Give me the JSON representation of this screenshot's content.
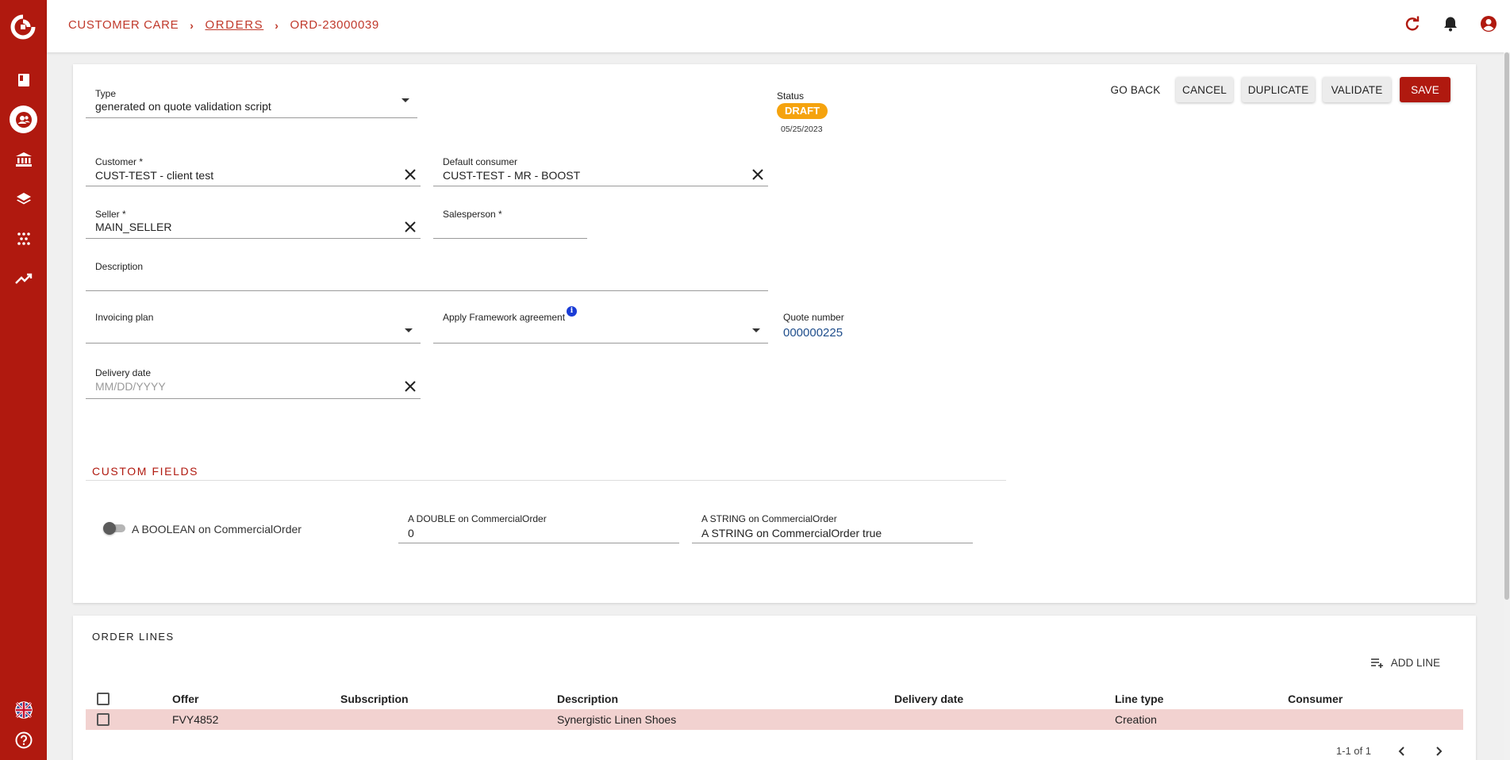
{
  "breadcrumb": {
    "root": "CUSTOMER CARE",
    "section": "ORDERS",
    "current": "ORD-23000039"
  },
  "icons": {
    "sidebar": [
      "app-logo",
      "book-icon",
      "customers-icon",
      "bank-icon",
      "layers-icon",
      "dots-grid-icon",
      "trending-icon",
      "language-flag-icon",
      "help-icon"
    ],
    "topbar": [
      "refresh-icon",
      "bell-icon",
      "account-icon"
    ]
  },
  "colors": {
    "brand": "#b0190f",
    "status_draft": "#f5a30e",
    "link": "#1f4e8c",
    "selected_row": "#f2d2d0"
  },
  "actions": {
    "go_back": "GO BACK",
    "cancel": "CANCEL",
    "duplicate": "DUPLICATE",
    "validate": "VALIDATE",
    "save": "SAVE"
  },
  "status": {
    "label": "Status",
    "value": "DRAFT",
    "date": "05/25/2023"
  },
  "form": {
    "type": {
      "label": "Type",
      "value": "generated on quote validation script"
    },
    "customer": {
      "label": "Customer *",
      "value": "CUST-TEST - client test"
    },
    "default_consumer": {
      "label": "Default consumer",
      "value": "CUST-TEST - MR - BOOST"
    },
    "seller": {
      "label": "Seller *",
      "value": "MAIN_SELLER"
    },
    "salesperson": {
      "label": "Salesperson *",
      "value": ""
    },
    "description": {
      "label": "Description",
      "value": ""
    },
    "invoicing_plan": {
      "label": "Invoicing plan",
      "value": ""
    },
    "framework_agreement": {
      "label": "Apply Framework agreement",
      "value": "",
      "info": "i"
    },
    "quote_number": {
      "label": "Quote number",
      "value": "000000225"
    },
    "delivery_date": {
      "label": "Delivery date",
      "placeholder": "MM/DD/YYYY"
    }
  },
  "custom_fields": {
    "title": "CUSTOM FIELDS",
    "boolean": {
      "label": "A BOOLEAN on CommercialOrder",
      "checked": false
    },
    "double": {
      "label": "A DOUBLE on CommercialOrder",
      "value": "0"
    },
    "string": {
      "label": "A STRING on CommercialOrder",
      "value": "A STRING on CommercialOrder true"
    }
  },
  "order_lines": {
    "title": "ORDER LINES",
    "add_line": "ADD LINE",
    "columns": [
      "Offer",
      "Subscription",
      "Description",
      "Delivery date",
      "Line type",
      "Consumer"
    ],
    "rows": [
      {
        "offer": "FVY4852",
        "subscription": "",
        "description": "Synergistic Linen Shoes",
        "delivery_date": "",
        "line_type": "Creation",
        "consumer": ""
      }
    ],
    "pagination": "1-1 of 1"
  }
}
